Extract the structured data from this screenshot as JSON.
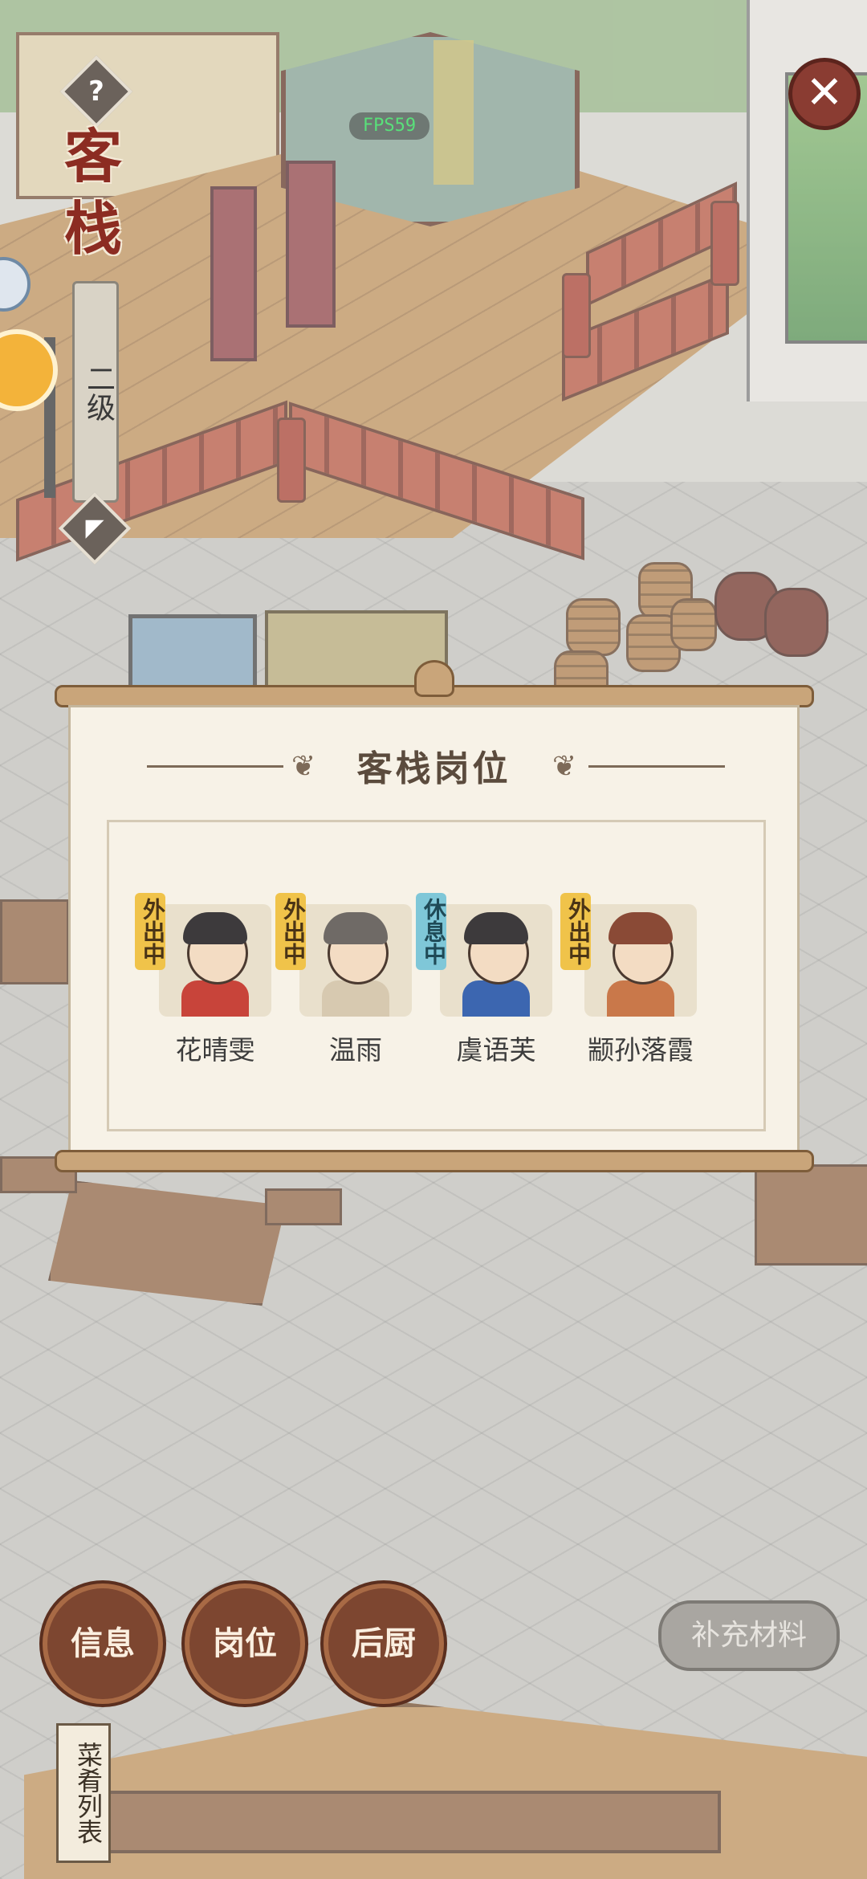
{
  "hud": {
    "fps": "FPS59",
    "help_icon": "?",
    "close_icon": "✕",
    "building_name": "客栈",
    "level_text": "二级",
    "upgrade_icon": "up-arrow"
  },
  "panel": {
    "title": "客栈岗位",
    "staff": [
      {
        "name": "花晴雯",
        "status": "外出中",
        "status_type": "out",
        "outfit_color": "#c8443a"
      },
      {
        "name": "温雨",
        "status": "外出中",
        "status_type": "out",
        "outfit_color": "#d7c9b0"
      },
      {
        "name": "虞语芙",
        "status": "休息中",
        "status_type": "rest",
        "outfit_color": "#3c66b0"
      },
      {
        "name": "颛孙落霞",
        "status": "外出中",
        "status_type": "out",
        "outfit_color": "#c9784a"
      }
    ]
  },
  "bottom": {
    "buttons": [
      "信息",
      "岗位",
      "后厨"
    ],
    "replenish_label": "补充材料",
    "menu_list_label": "菜肴列表"
  },
  "colors": {
    "accent_red": "#8c2c22",
    "out_badge": "#f0c34a",
    "rest_badge": "#7fc7d8",
    "button_brown": "#7d4630"
  }
}
